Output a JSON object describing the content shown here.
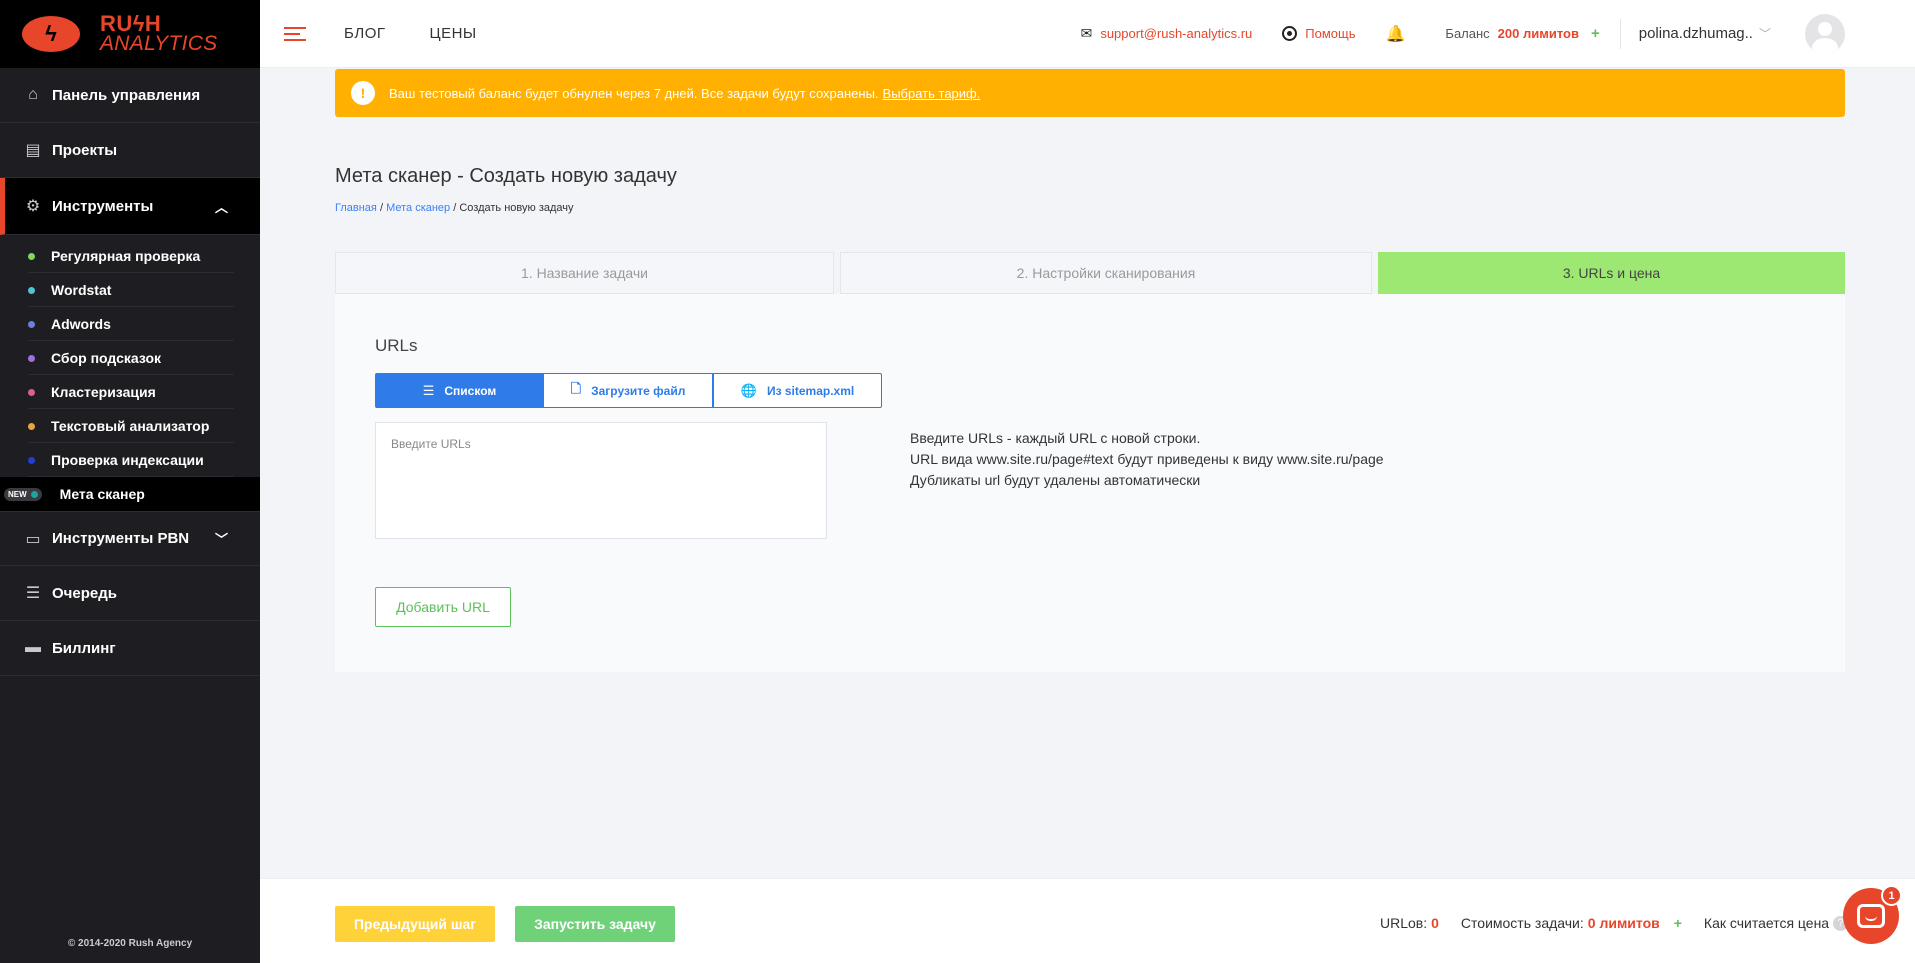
{
  "brand": {
    "line1": "RUϟH",
    "line2": "ANALYTICS",
    "mark": "ϟ"
  },
  "sidebar": {
    "items": [
      {
        "label": "Панель управления",
        "icon": "home-icon"
      },
      {
        "label": "Проекты",
        "icon": "projects-icon"
      },
      {
        "label": "Инструменты",
        "icon": "tools-icon"
      },
      {
        "label": "Инструменты PBN",
        "icon": "folder-icon"
      },
      {
        "label": "Очередь",
        "icon": "queue-icon"
      },
      {
        "label": "Биллинг",
        "icon": "billing-icon"
      }
    ],
    "tools": [
      {
        "label": "Регулярная проверка",
        "color": "#7ed957"
      },
      {
        "label": "Wordstat",
        "color": "#4fc3d9"
      },
      {
        "label": "Adwords",
        "color": "#6b7fe0"
      },
      {
        "label": "Сбор подсказок",
        "color": "#a06fe0"
      },
      {
        "label": "Кластеризация",
        "color": "#e45b8f"
      },
      {
        "label": "Текстовый анализатор",
        "color": "#f0a33a"
      },
      {
        "label": "Проверка индексации",
        "color": "#1e3fd8"
      },
      {
        "label": "Мета сканер",
        "color": "#1fa3a0"
      }
    ],
    "new_badge": "NEW",
    "copyright": "© 2014-2020 Rush Agency"
  },
  "header": {
    "blog": "БЛОГ",
    "prices": "ЦЕНЫ",
    "support_email": "support@rush-analytics.ru",
    "help": "Помощь",
    "balance_label": "Баланс",
    "balance_value": "200 лимитов",
    "user": "polina.dzhumag.."
  },
  "alert": {
    "text": "Ваш тестовый баланс будет обнулен через 7 дней. Все задачи будут сохранены.",
    "link": "Выбрать тариф."
  },
  "page": {
    "title": "Мета сканер - Создать новую задачу",
    "breadcrumb": {
      "home": "Главная",
      "section": "Мета сканер",
      "sep": "/",
      "current": "Создать новую задачу"
    }
  },
  "steps": [
    "1. Название задачи",
    "2. Настройки сканирования",
    "3. URLs и цена"
  ],
  "urls": {
    "label": "URLs",
    "tabs": [
      "Списком",
      "Загрузите файл",
      "Из sitemap.xml"
    ],
    "placeholder": "Введите URLs",
    "hints": [
      "Введите URLs - каждый URL с новой строки.",
      "URL вида www.site.ru/page#text будут приведены к виду www.site.ru/page",
      "Дубликаты url будут удалены автоматически"
    ],
    "add_button": "Добавить URL"
  },
  "footer": {
    "prev": "Предыдущий шаг",
    "run": "Запустить задачу",
    "urls_label": "URLов:",
    "urls_count": "0",
    "cost_label": "Стоимость задачи:",
    "cost_value": "0 лимитов",
    "how": "Как считается цена",
    "q": "?"
  },
  "chat": {
    "count": "1"
  }
}
